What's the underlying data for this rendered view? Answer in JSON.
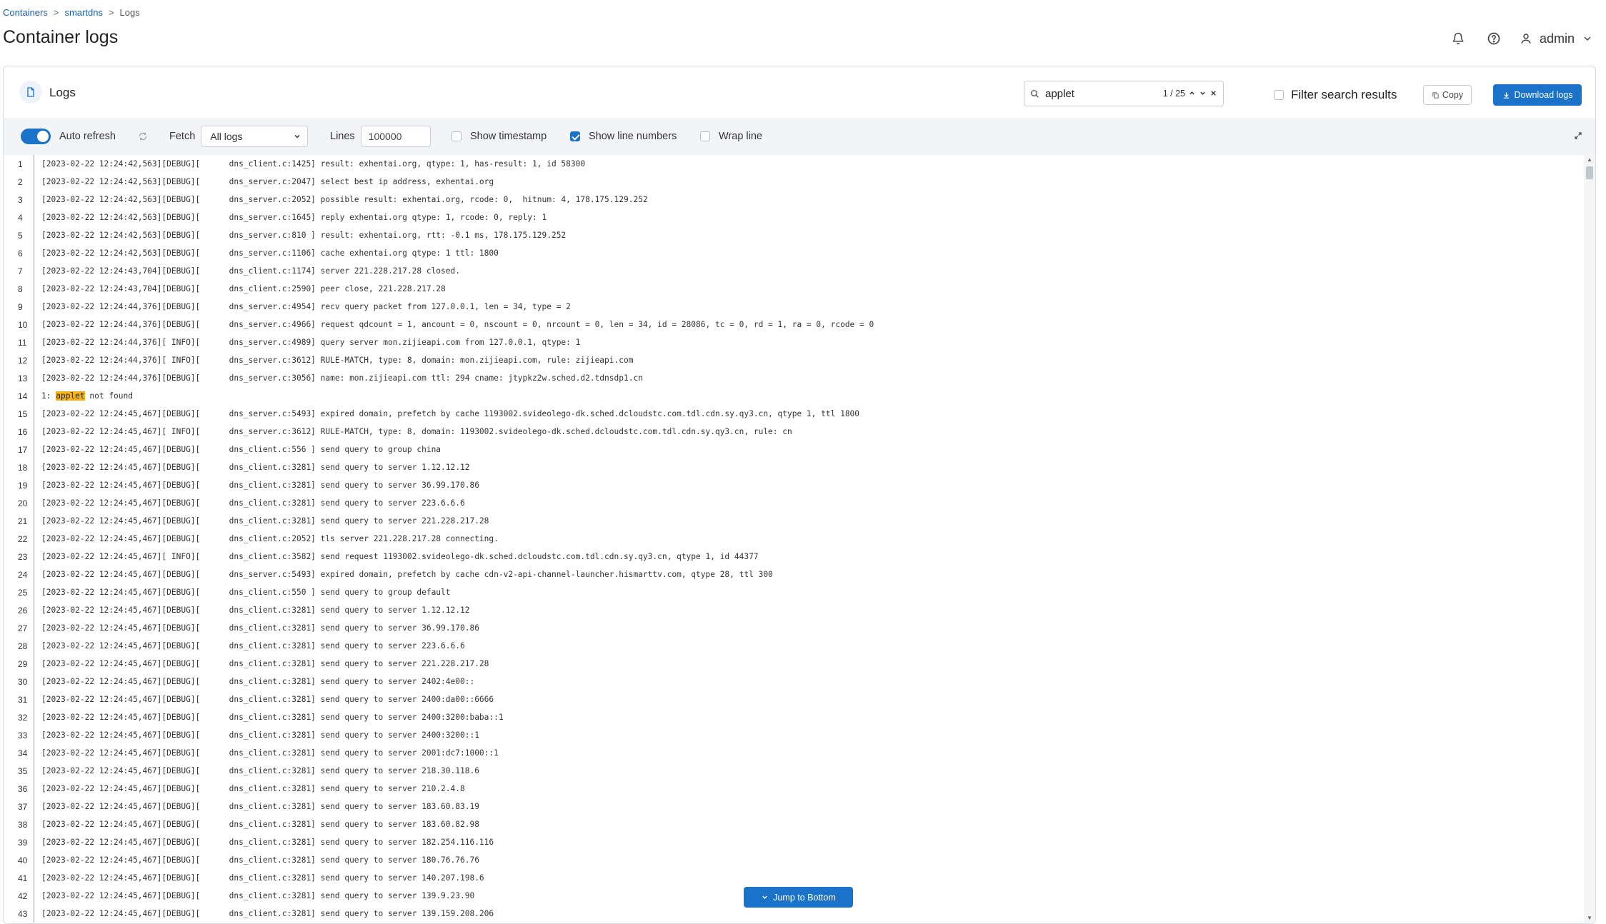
{
  "breadcrumb": {
    "items": [
      "Containers",
      "smartdns",
      "Logs"
    ],
    "separator": ">"
  },
  "page": {
    "title": "Container logs"
  },
  "user": {
    "name": "admin"
  },
  "card": {
    "title": "Logs"
  },
  "search": {
    "value": "applet",
    "count": "1 / 25"
  },
  "filter": {
    "label": "Filter search results",
    "checked": false
  },
  "buttons": {
    "copy": "Copy",
    "download": "Download logs",
    "jump": "Jump to Bottom"
  },
  "toolbar": {
    "auto_refresh": "Auto refresh",
    "fetch_label": "Fetch",
    "fetch_value": "All logs",
    "lines_label": "Lines",
    "lines_value": "100000",
    "show_timestamp": "Show timestamp",
    "show_line_numbers": "Show line numbers",
    "wrap_line": "Wrap line"
  },
  "colors": {
    "accent": "#1a73c9",
    "highlight": "#f5b21a"
  },
  "logs": [
    {
      "n": "1",
      "t": "[2023-02-22 12:24:42,563][DEBUG][      dns_client.c:1425] result: exhentai.org, qtype: 1, has-result: 1, id 58300"
    },
    {
      "n": "2",
      "t": "[2023-02-22 12:24:42,563][DEBUG][      dns_server.c:2047] select best ip address, exhentai.org"
    },
    {
      "n": "3",
      "t": "[2023-02-22 12:24:42,563][DEBUG][      dns_server.c:2052] possible result: exhentai.org, rcode: 0,  hitnum: 4, 178.175.129.252"
    },
    {
      "n": "4",
      "t": "[2023-02-22 12:24:42,563][DEBUG][      dns_server.c:1645] reply exhentai.org qtype: 1, rcode: 0, reply: 1"
    },
    {
      "n": "5",
      "t": "[2023-02-22 12:24:42,563][DEBUG][      dns_server.c:810 ] result: exhentai.org, rtt: -0.1 ms, 178.175.129.252"
    },
    {
      "n": "6",
      "t": "[2023-02-22 12:24:42,563][DEBUG][      dns_server.c:1106] cache exhentai.org qtype: 1 ttl: 1800"
    },
    {
      "n": "7",
      "t": "[2023-02-22 12:24:43,704][DEBUG][      dns_client.c:1174] server 221.228.217.28 closed."
    },
    {
      "n": "8",
      "t": "[2023-02-22 12:24:43,704][DEBUG][      dns_client.c:2590] peer close, 221.228.217.28"
    },
    {
      "n": "9",
      "t": "[2023-02-22 12:24:44,376][DEBUG][      dns_server.c:4954] recv query packet from 127.0.0.1, len = 34, type = 2"
    },
    {
      "n": "10",
      "t": "[2023-02-22 12:24:44,376][DEBUG][      dns_server.c:4966] request qdcount = 1, ancount = 0, nscount = 0, nrcount = 0, len = 34, id = 28086, tc = 0, rd = 1, ra = 0, rcode = 0"
    },
    {
      "n": "11",
      "t": "[2023-02-22 12:24:44,376][ INFO][      dns_server.c:4989] query server mon.zijieapi.com from 127.0.0.1, qtype: 1"
    },
    {
      "n": "12",
      "t": "[2023-02-22 12:24:44,376][ INFO][      dns_server.c:3612] RULE-MATCH, type: 8, domain: mon.zijieapi.com, rule: zijieapi.com"
    },
    {
      "n": "13",
      "t": "[2023-02-22 12:24:44,376][DEBUG][      dns_server.c:3056] name: mon.zijieapi.com ttl: 294 cname: jtypkz2w.sched.d2.tdnsdp1.cn"
    },
    {
      "n": "14",
      "pre": "1: ",
      "hl": "applet",
      "post": " not found"
    },
    {
      "n": "15",
      "t": "[2023-02-22 12:24:45,467][DEBUG][      dns_server.c:5493] expired domain, prefetch by cache 1193002.svideolego-dk.sched.dcloudstc.com.tdl.cdn.sy.qy3.cn, qtype 1, ttl 1800"
    },
    {
      "n": "16",
      "t": "[2023-02-22 12:24:45,467][ INFO][      dns_server.c:3612] RULE-MATCH, type: 8, domain: 1193002.svideolego-dk.sched.dcloudstc.com.tdl.cdn.sy.qy3.cn, rule: cn"
    },
    {
      "n": "17",
      "t": "[2023-02-22 12:24:45,467][DEBUG][      dns_client.c:556 ] send query to group china"
    },
    {
      "n": "18",
      "t": "[2023-02-22 12:24:45,467][DEBUG][      dns_client.c:3281] send query to server 1.12.12.12"
    },
    {
      "n": "19",
      "t": "[2023-02-22 12:24:45,467][DEBUG][      dns_client.c:3281] send query to server 36.99.170.86"
    },
    {
      "n": "20",
      "t": "[2023-02-22 12:24:45,467][DEBUG][      dns_client.c:3281] send query to server 223.6.6.6"
    },
    {
      "n": "21",
      "t": "[2023-02-22 12:24:45,467][DEBUG][      dns_client.c:3281] send query to server 221.228.217.28"
    },
    {
      "n": "22",
      "t": "[2023-02-22 12:24:45,467][DEBUG][      dns_client.c:2052] tls server 221.228.217.28 connecting."
    },
    {
      "n": "23",
      "t": "[2023-02-22 12:24:45,467][ INFO][      dns_client.c:3582] send request 1193002.svideolego-dk.sched.dcloudstc.com.tdl.cdn.sy.qy3.cn, qtype 1, id 44377"
    },
    {
      "n": "24",
      "t": "[2023-02-22 12:24:45,467][DEBUG][      dns_server.c:5493] expired domain, prefetch by cache cdn-v2-api-channel-launcher.hismarttv.com, qtype 28, ttl 300"
    },
    {
      "n": "25",
      "t": "[2023-02-22 12:24:45,467][DEBUG][      dns_client.c:550 ] send query to group default"
    },
    {
      "n": "26",
      "t": "[2023-02-22 12:24:45,467][DEBUG][      dns_client.c:3281] send query to server 1.12.12.12"
    },
    {
      "n": "27",
      "t": "[2023-02-22 12:24:45,467][DEBUG][      dns_client.c:3281] send query to server 36.99.170.86"
    },
    {
      "n": "28",
      "t": "[2023-02-22 12:24:45,467][DEBUG][      dns_client.c:3281] send query to server 223.6.6.6"
    },
    {
      "n": "29",
      "t": "[2023-02-22 12:24:45,467][DEBUG][      dns_client.c:3281] send query to server 221.228.217.28"
    },
    {
      "n": "30",
      "t": "[2023-02-22 12:24:45,467][DEBUG][      dns_client.c:3281] send query to server 2402:4e00::"
    },
    {
      "n": "31",
      "t": "[2023-02-22 12:24:45,467][DEBUG][      dns_client.c:3281] send query to server 2400:da00::6666"
    },
    {
      "n": "32",
      "t": "[2023-02-22 12:24:45,467][DEBUG][      dns_client.c:3281] send query to server 2400:3200:baba::1"
    },
    {
      "n": "33",
      "t": "[2023-02-22 12:24:45,467][DEBUG][      dns_client.c:3281] send query to server 2400:3200::1"
    },
    {
      "n": "34",
      "t": "[2023-02-22 12:24:45,467][DEBUG][      dns_client.c:3281] send query to server 2001:dc7:1000::1"
    },
    {
      "n": "35",
      "t": "[2023-02-22 12:24:45,467][DEBUG][      dns_client.c:3281] send query to server 218.30.118.6"
    },
    {
      "n": "36",
      "t": "[2023-02-22 12:24:45,467][DEBUG][      dns_client.c:3281] send query to server 210.2.4.8"
    },
    {
      "n": "37",
      "t": "[2023-02-22 12:24:45,467][DEBUG][      dns_client.c:3281] send query to server 183.60.83.19"
    },
    {
      "n": "38",
      "t": "[2023-02-22 12:24:45,467][DEBUG][      dns_client.c:3281] send query to server 183.60.82.98"
    },
    {
      "n": "39",
      "t": "[2023-02-22 12:24:45,467][DEBUG][      dns_client.c:3281] send query to server 182.254.116.116"
    },
    {
      "n": "40",
      "t": "[2023-02-22 12:24:45,467][DEBUG][      dns_client.c:3281] send query to server 180.76.76.76"
    },
    {
      "n": "41",
      "t": "[2023-02-22 12:24:45,467][DEBUG][      dns_client.c:3281] send query to server 140.207.198.6"
    },
    {
      "n": "42",
      "t": "[2023-02-22 12:24:45,467][DEBUG][      dns_client.c:3281] send query to server 139.9.23.90"
    },
    {
      "n": "43",
      "t": "[2023-02-22 12:24:45,467][DEBUG][      dns_client.c:3281] send query to server 139.159.208.206"
    }
  ]
}
